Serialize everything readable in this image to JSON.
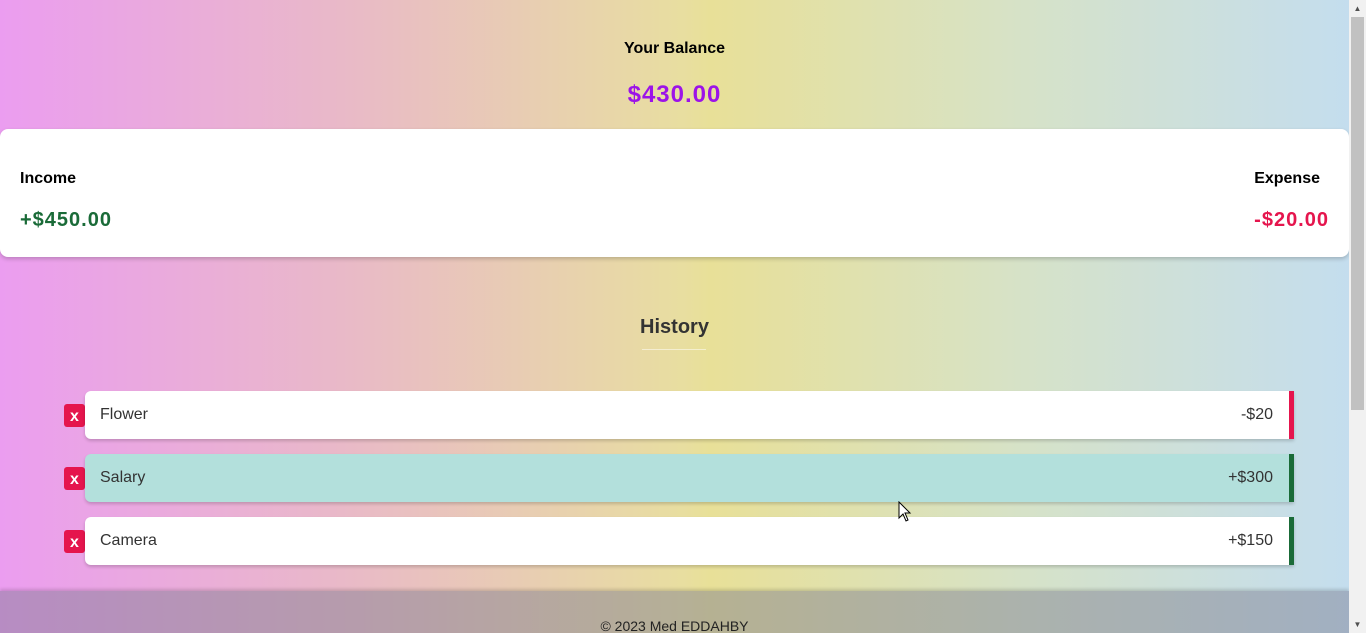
{
  "balance": {
    "title": "Your Balance",
    "amount": "$430.00"
  },
  "summary": {
    "income_label": "Income",
    "income_amount": "+$450.00",
    "expense_label": "Expense",
    "expense_amount": "-$20.00"
  },
  "history": {
    "title": "History",
    "delete_label": "x",
    "transactions": [
      {
        "name": "Flower",
        "amount": "-$20",
        "type": "minus"
      },
      {
        "name": "Salary",
        "amount": "+$300",
        "type": "plus"
      },
      {
        "name": "Camera",
        "amount": "+$150",
        "type": "plus"
      }
    ]
  },
  "footer": {
    "text": "© 2023 Med EDDAHBY"
  },
  "colors": {
    "balance": "#9c13e8",
    "income": "#1a6b38",
    "expense": "#e5154d",
    "hover_row": "#b3e0dc"
  }
}
